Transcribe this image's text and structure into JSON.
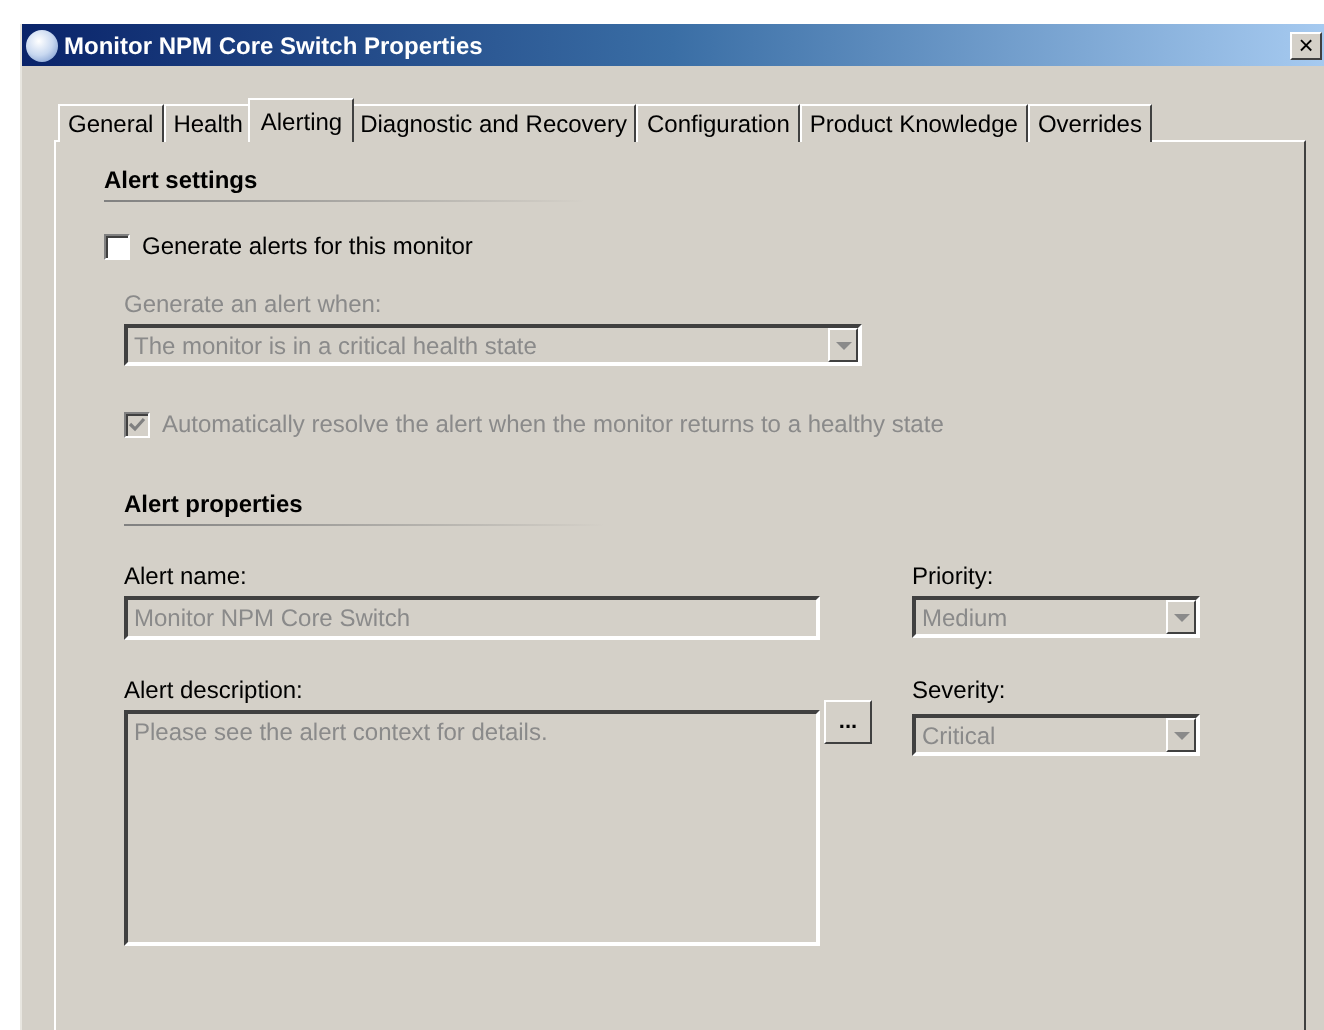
{
  "window": {
    "title": "Monitor NPM Core Switch Properties",
    "close": "×"
  },
  "tabs": [
    {
      "label": "General",
      "selected": false
    },
    {
      "label": "Health",
      "selected": false
    },
    {
      "label": "Alerting",
      "selected": true
    },
    {
      "label": "Diagnostic and Recovery",
      "selected": false
    },
    {
      "label": "Configuration",
      "selected": false
    },
    {
      "label": "Product Knowledge",
      "selected": false
    },
    {
      "label": "Overrides",
      "selected": false
    }
  ],
  "alert_settings": {
    "heading": "Alert settings",
    "generate_alerts": {
      "label": "Generate alerts for this monitor",
      "checked": false
    },
    "alert_when": {
      "label": "Generate an alert when:",
      "value": "The monitor is in a critical health state",
      "disabled": true
    },
    "auto_resolve": {
      "label": "Automatically resolve the alert when the monitor returns to a healthy state",
      "checked": true,
      "disabled": true
    }
  },
  "alert_properties": {
    "heading": "Alert properties",
    "alert_name": {
      "label": "Alert name:",
      "value": "Monitor NPM Core Switch",
      "disabled": true
    },
    "priority": {
      "label": "Priority:",
      "value": "Medium",
      "disabled": true
    },
    "alert_description": {
      "label": "Alert description:",
      "value": "Please see the alert context for details.",
      "disabled": true
    },
    "more_button": "...",
    "severity": {
      "label": "Severity:",
      "value": "Critical",
      "disabled": true
    }
  }
}
